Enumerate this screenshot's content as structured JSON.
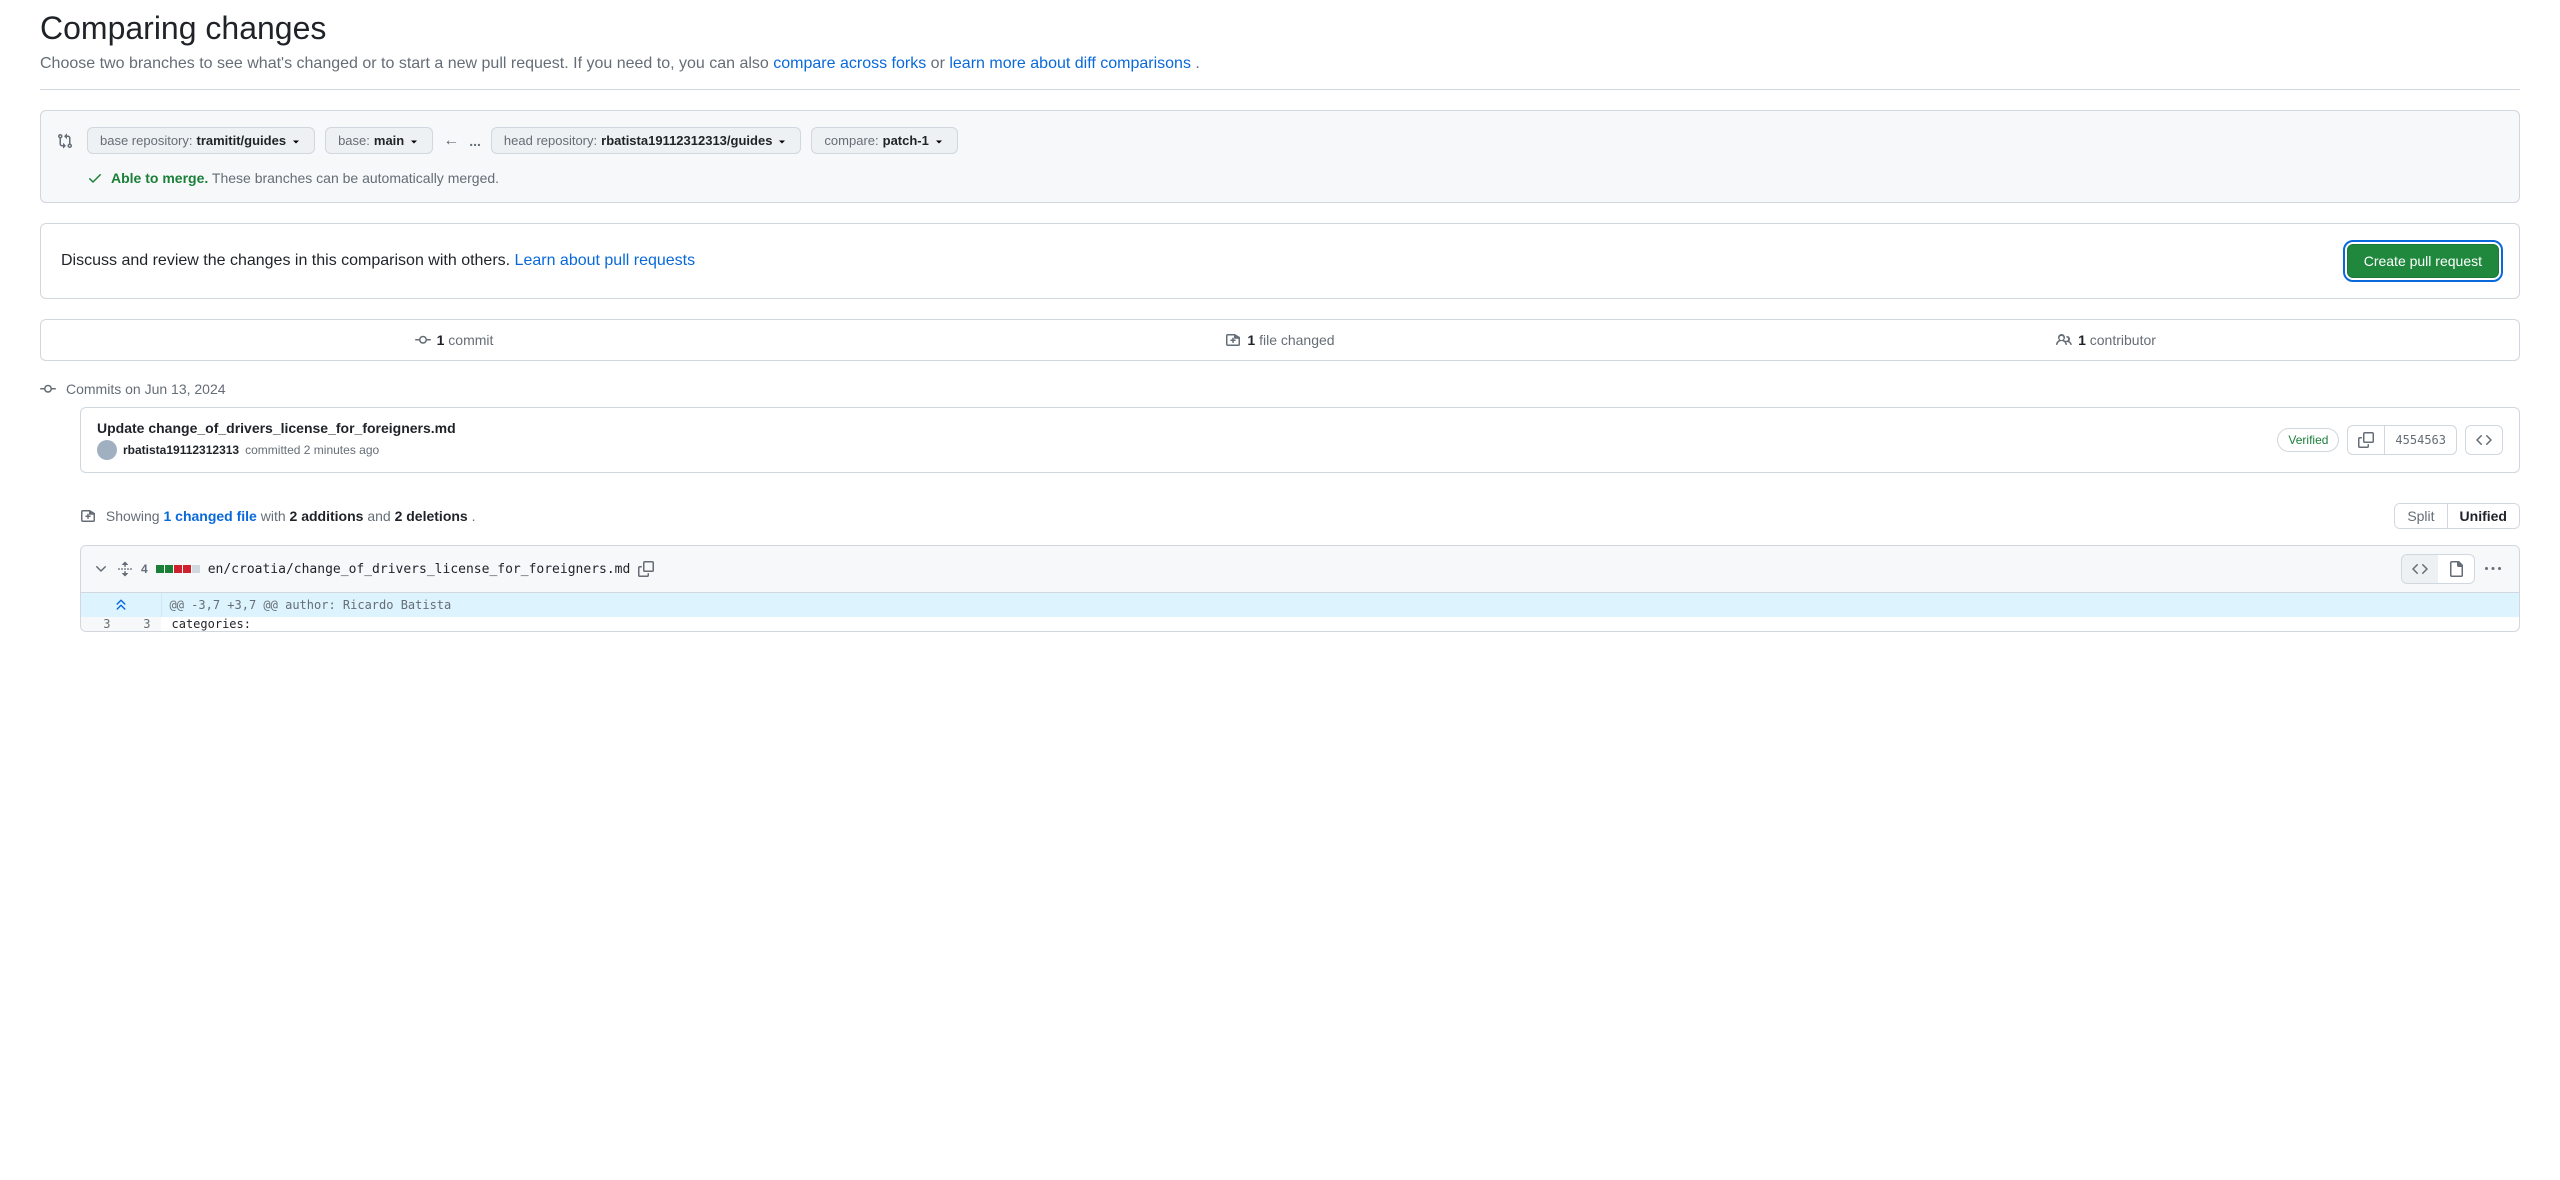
{
  "page": {
    "title": "Comparing changes",
    "subtitle_part1": "Choose two branches to see what's changed or to start a new pull request. If you need to, you can also ",
    "subtitle_link1": "compare across forks",
    "subtitle_part2": " or ",
    "subtitle_link2": "learn more about diff comparisons",
    "subtitle_part3": "."
  },
  "branch_selector": {
    "base_repo_label": "base repository: ",
    "base_repo_value": "tramitit/guides",
    "base_label": "base: ",
    "base_value": "main",
    "head_repo_label": "head repository: ",
    "head_repo_value": "rbatista19112312313/guides",
    "compare_label": "compare: ",
    "compare_value": "patch-1",
    "arrow": "←",
    "ellipsis": "..."
  },
  "merge_status": {
    "able_text": "Able to merge.",
    "details": " These branches can be automatically merged."
  },
  "discuss": {
    "text": "Discuss and review the changes in this comparison with others. ",
    "link": "Learn about pull requests",
    "button": "Create pull request"
  },
  "stats": {
    "commit_count": "1",
    "commit_label": " commit",
    "file_count": "1",
    "file_label": " file changed",
    "contributor_count": "1",
    "contributor_label": " contributor"
  },
  "commits": {
    "header": "Commits on Jun 13, 2024",
    "items": [
      {
        "title": "Update change_of_drivers_license_for_foreigners.md",
        "author": "rbatista19112312313",
        "committed_text": " committed 2 minutes ago",
        "verified": "Verified",
        "sha": "4554563"
      }
    ]
  },
  "showing": {
    "prefix": "Showing ",
    "file_link": "1 changed file",
    "with_text": " with ",
    "additions": "2 additions",
    "and_text": " and ",
    "deletions": "2 deletions",
    "period": "."
  },
  "view_toggle": {
    "split": "Split",
    "unified": "Unified"
  },
  "file": {
    "change_count": "4",
    "path": "en/croatia/change_of_drivers_license_for_foreigners.md",
    "hunk_header": "@@ -3,7 +3,7 @@ author: Ricardo Batista",
    "lines": [
      {
        "old": "3",
        "new": "3",
        "content": "categories:"
      }
    ]
  }
}
